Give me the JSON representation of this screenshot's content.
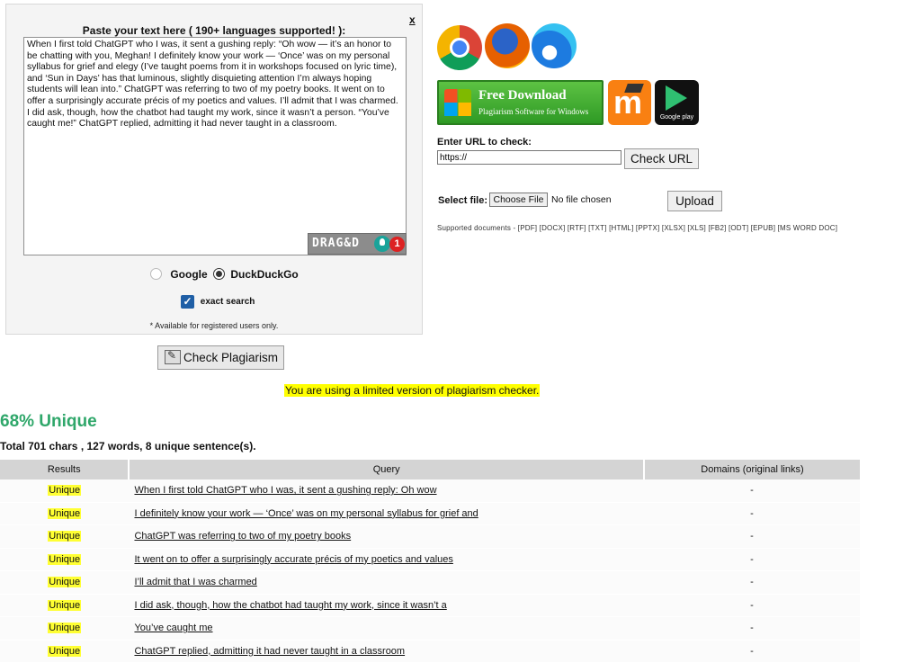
{
  "panel": {
    "title": "Paste your text here ( 190+ languages supported! ):",
    "close": "x",
    "text": "When I first told ChatGPT who I was, it sent a gushing reply: “Oh wow — it’s an honor to be chatting with you, Meghan! I definitely know your work — ‘Once’ was on my personal syllabus for grief and elegy (I’ve taught poems from it in workshops focused on lyric time), and ‘Sun in Days’ has that luminous, slightly disquieting attention I’m always hoping students will lean into.” ChatGPT was referring to two of my poetry books. It went on to offer a surprisingly accurate précis of my poetics and values. I’ll admit that I was charmed. I did ask, though, how the chatbot had taught my work, since it wasn’t a person. “You’ve caught me!” ChatGPT replied, admitting it had never taught in a classroom.",
    "drag_label": "DRAG&D",
    "notif_count": "1",
    "engine_google": "Google",
    "engine_ddg": "DuckDuckGo",
    "exact_search": "exact search",
    "registered_note": "* Available for registered users only."
  },
  "check_button": "Check Plagiarism",
  "download": {
    "title": "Free Download",
    "subtitle": "Plagiarism Software for Windows",
    "gplay_label": "Google play"
  },
  "url": {
    "label": "Enter URL to check:",
    "value": "https://",
    "button": "Check URL"
  },
  "file": {
    "label": "Select file:",
    "choose": "Choose File",
    "none": "No file chosen",
    "upload": "Upload",
    "supported": "Supported documents - [PDF] [DOCX] [RTF] [TXT] [HTML] [PPTX] [XLSX] [XLS] [FB2] [ODT] [EPUB] [MS WORD DOC]"
  },
  "results": {
    "limited_note": "You are using a limited version of plagiarism checker.",
    "unique_percent": "68% Unique",
    "totals": "Total 701 chars , 127 words, 8 unique sentence(s).",
    "columns": [
      "Results",
      "Query",
      "Domains (original links)"
    ],
    "rows": [
      {
        "result": "Unique",
        "query": "When I first told ChatGPT who I was, it sent a gushing reply: Oh wow",
        "domain": "-"
      },
      {
        "result": "Unique",
        "query": "I definitely know your work — ‘Once’ was on my personal syllabus for grief and",
        "domain": "-"
      },
      {
        "result": "Unique",
        "query": "ChatGPT was referring to two of my poetry books",
        "domain": "-"
      },
      {
        "result": "Unique",
        "query": "It went on to offer a surprisingly accurate précis of my poetics and values",
        "domain": "-"
      },
      {
        "result": "Unique",
        "query": "I’ll admit that I was charmed",
        "domain": "-"
      },
      {
        "result": "Unique",
        "query": "I did ask, though, how the chatbot had taught my work, since it wasn’t a",
        "domain": "-"
      },
      {
        "result": "Unique",
        "query": "You’ve caught me",
        "domain": "-"
      },
      {
        "result": "Unique",
        "query": "ChatGPT replied, admitting it had never taught in a classroom",
        "domain": "-"
      }
    ]
  }
}
